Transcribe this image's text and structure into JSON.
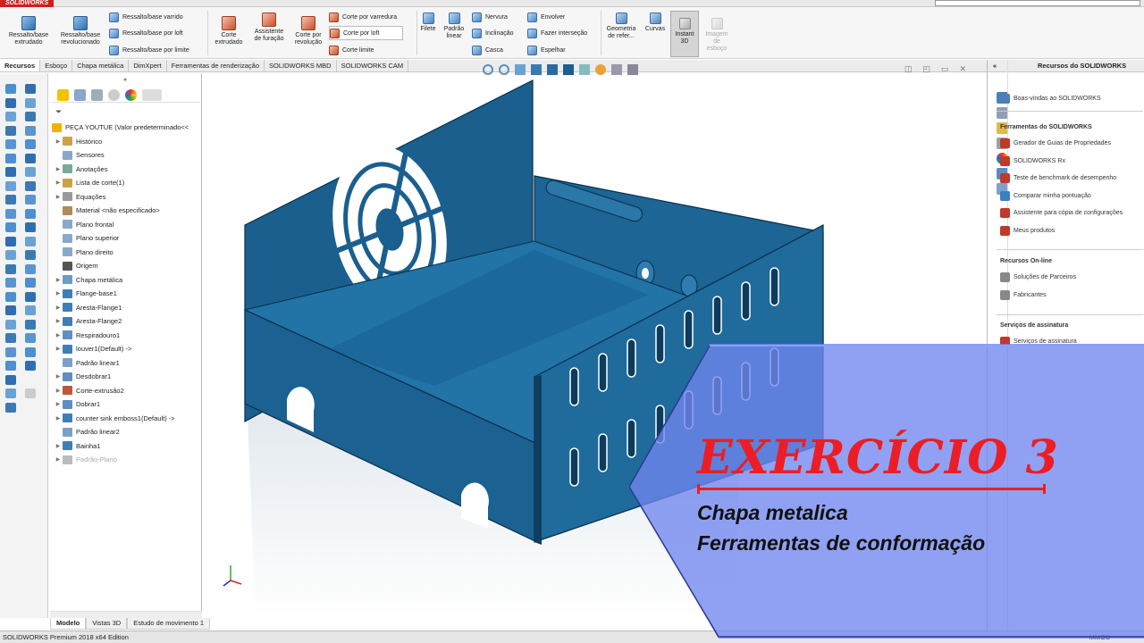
{
  "app": {
    "logo_text": "SOLIDWORKS",
    "status_text": "SOLIDWORKS Premium 2018 x64 Edition",
    "units": "MMGS"
  },
  "ribbon": {
    "buttons": [
      {
        "label": "Ressalto/base extrudado",
        "icon": "extrude-boss-icon"
      },
      {
        "label": "Ressalto/base revolucionado",
        "icon": "revolve-boss-icon"
      },
      {
        "label": "Corte extrudado",
        "icon": "extrude-cut-icon"
      },
      {
        "label": "Assistente de furação",
        "icon": "hole-wizard-icon"
      },
      {
        "label": "Corte por revolução",
        "icon": "revolve-cut-icon"
      },
      {
        "label": "Filete",
        "icon": "fillet-icon"
      },
      {
        "label": "Padrão linear",
        "icon": "linear-pattern-icon"
      },
      {
        "label": "Geometria de refer...",
        "icon": "reference-geometry-icon"
      },
      {
        "label": "Curvas",
        "icon": "curves-icon"
      },
      {
        "label": "Instant 3D",
        "icon": "instant3d-icon"
      },
      {
        "label": "Imagem de esboço",
        "icon": "sketch-picture-icon"
      }
    ],
    "small": {
      "swept_boss": "Ressalto/base varrido",
      "loft_boss": "Ressalto/base por loft",
      "boundary_boss": "Ressalto/base por limite",
      "swept_cut": "Corte por varredura",
      "loft_cut": "Corte por loft",
      "boundary_cut": "Corte limite",
      "rib": "Nervura",
      "draft": "Inclinação",
      "shell": "Casca",
      "wrap": "Envolver",
      "intersect": "Fazer interseção",
      "mirror": "Espelhar"
    }
  },
  "tabs": [
    "Recursos",
    "Esboço",
    "Chapa metálica",
    "DimXpert",
    "Ferramentas de renderização",
    "SOLIDWORKS MBD",
    "SOLIDWORKS CAM"
  ],
  "active_tab": "Recursos",
  "feature_tree": {
    "root": "PEÇA YOUTUE  (Valor predeterminado<<",
    "items": [
      {
        "label": "Histórico",
        "arrow": true
      },
      {
        "label": "Sensores",
        "arrow": false
      },
      {
        "label": "Anotações",
        "arrow": true
      },
      {
        "label": "Lista de corte(1)",
        "arrow": true
      },
      {
        "label": "Equações",
        "arrow": true
      },
      {
        "label": "Material <não especificado>",
        "arrow": false
      },
      {
        "label": "Plano frontal",
        "arrow": false
      },
      {
        "label": "Plano superior",
        "arrow": false
      },
      {
        "label": "Plano direito",
        "arrow": false
      },
      {
        "label": "Origem",
        "arrow": false
      },
      {
        "label": "Chapa metálica",
        "arrow": true
      },
      {
        "label": "Flange-base1",
        "arrow": true
      },
      {
        "label": "Aresta-Flange1",
        "arrow": true
      },
      {
        "label": "Aresta-Flange2",
        "arrow": true
      },
      {
        "label": "Respiradouro1",
        "arrow": true
      },
      {
        "label": "louver1(Default) ->",
        "arrow": true
      },
      {
        "label": "Padrão linear1",
        "arrow": false
      },
      {
        "label": "Desdobrar1",
        "arrow": true
      },
      {
        "label": "Corte-extrusão2",
        "arrow": true
      },
      {
        "label": "Dobrar1",
        "arrow": true
      },
      {
        "label": "counter sink emboss1(Default) ->",
        "arrow": true
      },
      {
        "label": "Padrão linear2",
        "arrow": false
      },
      {
        "label": "Bainha1",
        "arrow": true
      },
      {
        "label": "Padrão-Plano",
        "arrow": true
      }
    ]
  },
  "bottom_tabs": [
    "Modelo",
    "Vistas 3D",
    "Estudo de movimento 1"
  ],
  "right_panel": {
    "title": "Recursos do SOLIDWORKS",
    "welcome": "Boas-vindas ao SOLIDWORKS",
    "tools_header": "Ferramentas do SOLIDWORKS",
    "tools": [
      "Gerador de Guias de Propriedades",
      "SOLIDWORKS Rx",
      "Teste de benchmark de desempenho",
      "Comparar minha pontuação",
      "Assistente para cópia de configurações",
      "Meus produtos"
    ],
    "online_header": "Recursos On-line",
    "online": [
      "Soluções de Parceiros",
      "Fabricantes"
    ],
    "subscription_header": "Serviços de assinatura",
    "subscription": [
      "Serviços de assinatura"
    ]
  },
  "overlay": {
    "title": "EXERCÍCIO 3",
    "line1": "Chapa metalica",
    "line2": "Ferramentas de conformação",
    "accent_color": "#ed1d24"
  },
  "model_color": "#1e6b9c"
}
